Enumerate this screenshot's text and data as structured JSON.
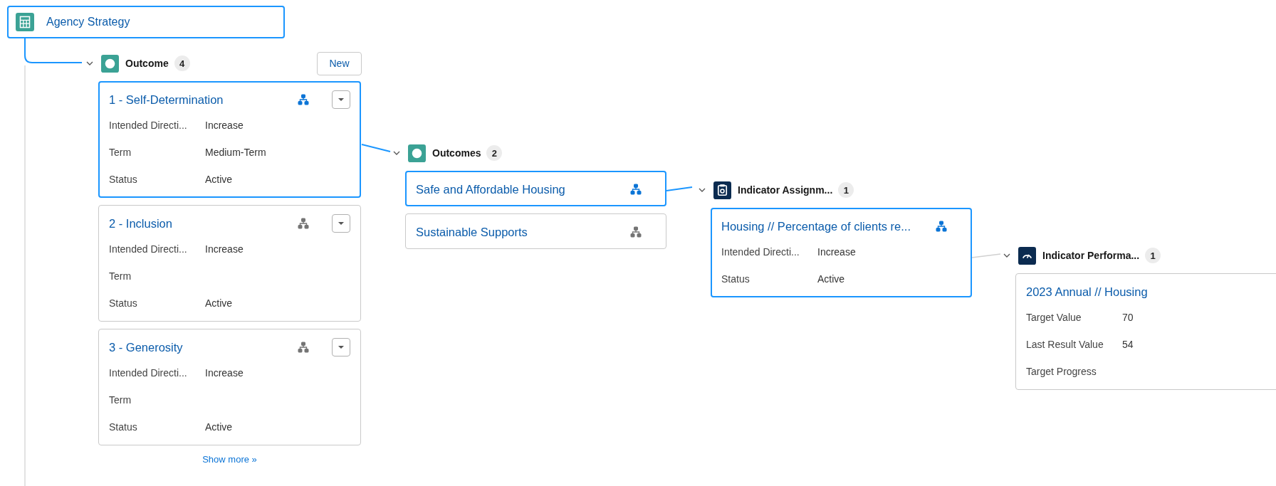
{
  "root": {
    "title": "Agency Strategy",
    "selected": true
  },
  "groups": [
    {
      "label": "Outcome",
      "count": "4",
      "kind": "outcome",
      "link_active": true,
      "new_button": "New",
      "show_more": "Show more »",
      "cards": [
        {
          "title": "1 - Self-Determination",
          "selected": true,
          "hierarchy": true,
          "menu": true,
          "fields": [
            {
              "label": "Intended Directi...",
              "value": "Increase"
            },
            {
              "label": "Term",
              "value": "Medium-Term"
            },
            {
              "label": "Status",
              "value": "Active"
            }
          ]
        },
        {
          "title": "2 - Inclusion",
          "selected": false,
          "hierarchy": true,
          "menu": true,
          "fields": [
            {
              "label": "Intended Directi...",
              "value": "Increase"
            },
            {
              "label": "Term"
            },
            {
              "label": "Status",
              "value": "Active"
            }
          ]
        },
        {
          "title": "3 - Generosity",
          "selected": false,
          "hierarchy": true,
          "menu": true,
          "fields": [
            {
              "label": "Intended Directi...",
              "value": "Increase"
            },
            {
              "label": "Term"
            },
            {
              "label": "Status",
              "value": "Active"
            }
          ]
        }
      ]
    },
    {
      "label": "Outcomes",
      "count": "2",
      "kind": "outcome",
      "link_active": true,
      "cards": [
        {
          "title": "Safe and Affordable Housing",
          "selected": true,
          "hierarchy": true,
          "menu": false
        },
        {
          "title": "Sustainable Supports",
          "selected": false,
          "hierarchy": true,
          "menu": false
        }
      ]
    },
    {
      "label": "Indicator Assignm...",
      "count": "1",
      "kind": "indicator-assignment",
      "link_active": true,
      "cards": [
        {
          "title": "Housing // Percentage of clients re...",
          "selected": true,
          "hierarchy": true,
          "menu": false,
          "fields": [
            {
              "label": "Intended Directi...",
              "value": "Increase"
            },
            {
              "label": "Status",
              "value": "Active"
            }
          ]
        }
      ]
    },
    {
      "label": "Indicator Performa...",
      "count": "1",
      "kind": "indicator-performance",
      "link_active": false,
      "cards": [
        {
          "title": "2023 Annual // Housing",
          "selected": false,
          "hierarchy": false,
          "menu": false,
          "fields": [
            {
              "label": "Target Value",
              "value": "70"
            },
            {
              "label": "Last Result Value",
              "value": "54"
            },
            {
              "label": "Target Progress"
            }
          ]
        }
      ]
    }
  ]
}
